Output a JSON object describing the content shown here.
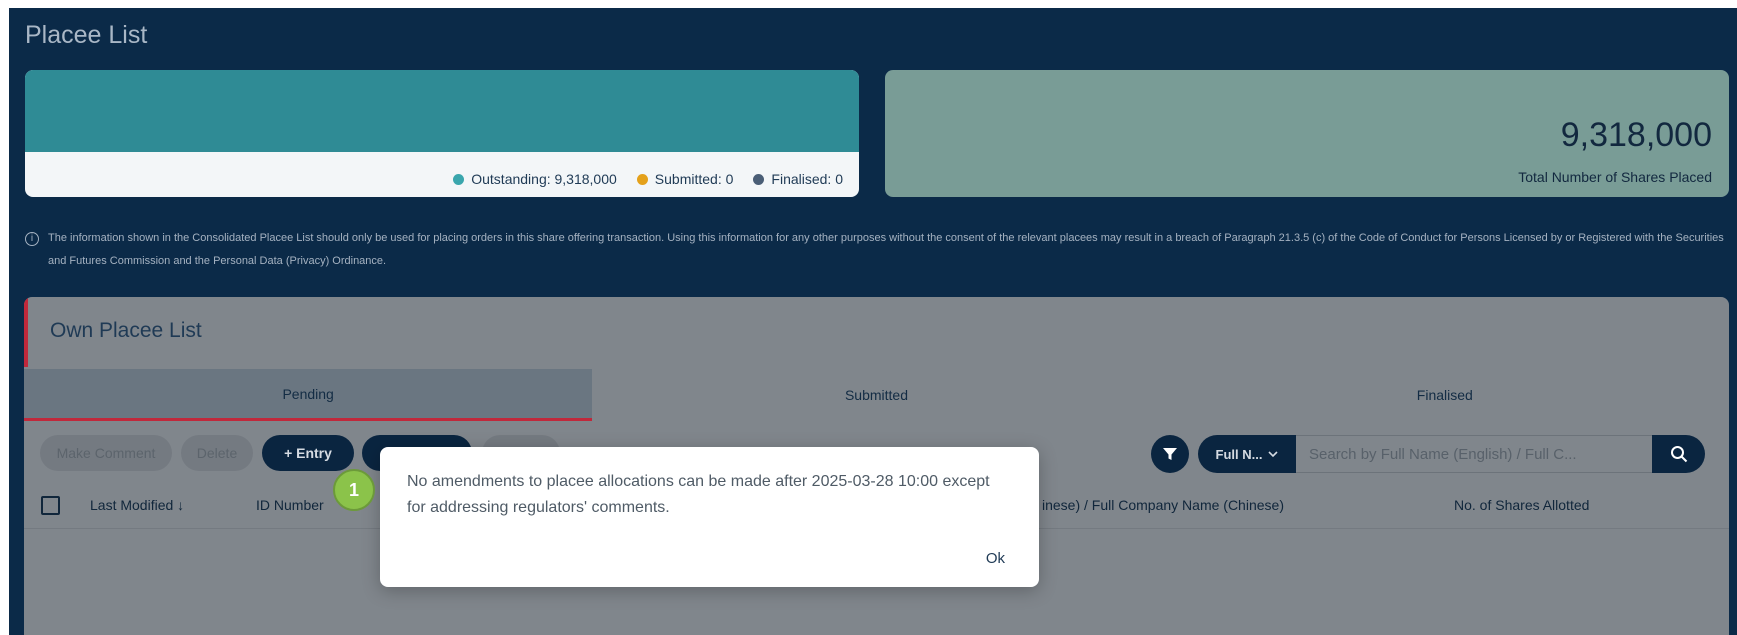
{
  "page": {
    "title": "Placee List"
  },
  "summary": {
    "legend": [
      {
        "label": "Outstanding: 9,318,000",
        "color": "#3aa6ad"
      },
      {
        "label": "Submitted: 0",
        "color": "#e4a11b"
      },
      {
        "label": "Finalised: 0",
        "color": "#4a5e76"
      }
    ],
    "total_number": "9,318,000",
    "total_caption": "Total Number of Shares Placed"
  },
  "notice": {
    "text": "The information shown in the Consolidated Placee List should only be used for placing orders in this share offering transaction. Using this information for any other purposes without the consent of the relevant placees may result in a breach of Paragraph 21.3.5 (c) of the Code of Conduct for Persons Licensed by or Registered with the Securities and Futures Commission and the Personal Data (Privacy) Ordinance."
  },
  "own_list": {
    "title": "Own Placee List",
    "tabs": [
      "Pending",
      "Submitted",
      "Finalised"
    ],
    "toolbar": {
      "make_comment": "Make Comment",
      "delete": "Delete",
      "entry": "+ Entry"
    },
    "search": {
      "field_select": "Full N...",
      "placeholder": "Search by Full Name (English) / Full C..."
    },
    "columns": {
      "last_modified": "Last Modified ↓",
      "id_number": "ID Number",
      "chinese_name": "inese) / Full Company Name (Chinese)",
      "shares_allotted": "No. of Shares Allotted"
    }
  },
  "dialog": {
    "message": "No amendments to placee allocations can be made after 2025-03-28 10:00 except for addressing regulators' comments.",
    "ok": "Ok"
  },
  "step_badge": "1",
  "colors": {
    "accent": "#c0283b",
    "navy": "#0b2a48"
  }
}
